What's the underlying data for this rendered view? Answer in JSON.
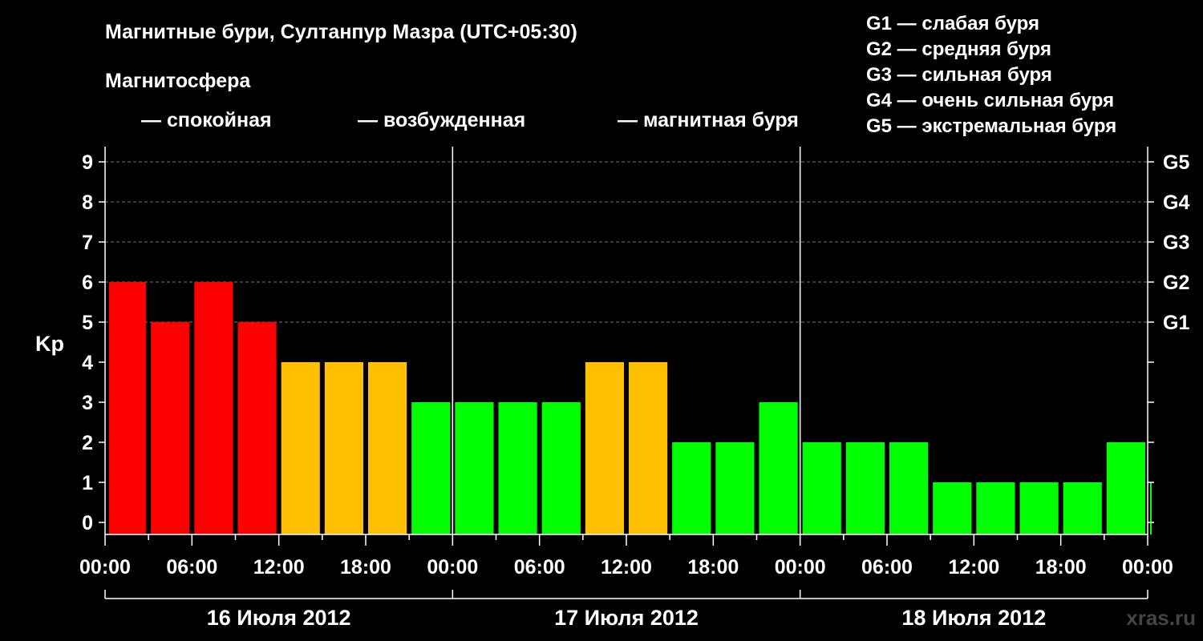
{
  "chart_data": {
    "type": "bar",
    "title": "Магнитные бури, Султанпур Мазра (UTC+05:30)",
    "ylabel": "Kp",
    "ylim": [
      0,
      9
    ],
    "yticks": [
      "0",
      "1",
      "2",
      "3",
      "4",
      "5",
      "6",
      "7",
      "8",
      "9"
    ],
    "storm_levels": [
      {
        "kp": 5,
        "label": "G1"
      },
      {
        "kp": 6,
        "label": "G2"
      },
      {
        "kp": 7,
        "label": "G3"
      },
      {
        "kp": 8,
        "label": "G4"
      },
      {
        "kp": 9,
        "label": "G5"
      }
    ],
    "storm_legend": [
      "G1 — слабая буря",
      "G2 — средняя буря",
      "G3 — сильная буря",
      "G4 — очень сильная буря",
      "G5 — экстремальная буря"
    ],
    "magnetosphere_legend": {
      "title": "Магнитосфера",
      "items": [
        {
          "label": "— спокойная",
          "color": "#00ff00"
        },
        {
          "label": "— возбужденная",
          "color": "#ffc000"
        },
        {
          "label": "— магнитная буря",
          "color": "#ff0000"
        }
      ]
    },
    "xtick_labels": [
      "00:00",
      "06:00",
      "12:00",
      "18:00",
      "00:00",
      "06:00",
      "12:00",
      "18:00",
      "00:00",
      "06:00",
      "12:00",
      "18:00",
      "00:00"
    ],
    "days": [
      "16 Июля 2012",
      "17 Июля 2012",
      "18 Июля 2012"
    ],
    "interval_hours": 3,
    "values": [
      6,
      5,
      6,
      5,
      4,
      4,
      4,
      3,
      3,
      3,
      3,
      4,
      4,
      2,
      2,
      3,
      2,
      2,
      2,
      1,
      1,
      1,
      1,
      2,
      1
    ],
    "grid": "dashed at Kp 5–9",
    "watermark": "xras.ru"
  }
}
